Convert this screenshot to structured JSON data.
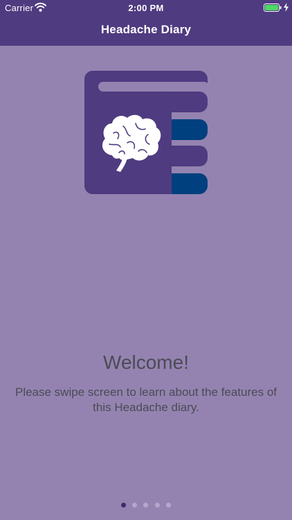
{
  "status_bar": {
    "carrier": "Carrier",
    "time": "2:00 PM",
    "wifi_icon": "wifi-icon",
    "battery_icon": "battery-icon",
    "charging_icon": "bolt-icon",
    "battery_color": "#4cd964"
  },
  "nav": {
    "title": "Headache Diary"
  },
  "onboarding": {
    "logo_icon": "brain-notebook-icon",
    "title": "Welcome!",
    "message": "Please swipe screen to learn about the features of this Headache diary."
  },
  "pager": {
    "page_count": 5,
    "current_page": 1
  },
  "colors": {
    "nav_bar": "#4f3b80",
    "background": "#9483b0",
    "logo_purple": "#4f3b80",
    "logo_blue": "#00407f",
    "text": "#4c4a56"
  }
}
